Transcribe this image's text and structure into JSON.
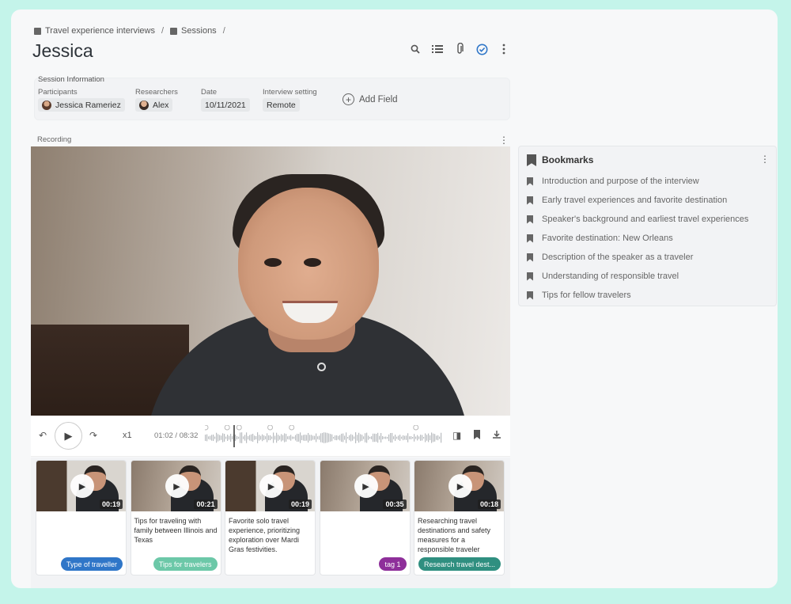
{
  "breadcrumb": {
    "project": "Travel experience interviews",
    "section": "Sessions",
    "sep": "/"
  },
  "page": {
    "title": "Jessica"
  },
  "toolbar": {
    "icons": [
      "search-icon",
      "list-icon",
      "paperclip-icon",
      "check-circle-icon",
      "more-vertical-icon"
    ]
  },
  "session": {
    "title": "Session Information",
    "participants_label": "Participants",
    "participant": "Jessica Rameriez",
    "researchers_label": "Researchers",
    "researcher": "Alex",
    "date_label": "Date",
    "date": "10/11/2021",
    "setting_label": "Interview setting",
    "setting": "Remote",
    "add_field": "Add Field"
  },
  "recording": {
    "label": "Recording",
    "speed": "x1",
    "time": "01:02 / 08:32",
    "progress": 0.12
  },
  "clips": [
    {
      "duration": "00:19",
      "text": "",
      "tag": "Type of traveller",
      "tag_color": "#2f76c8",
      "shelf": true
    },
    {
      "duration": "00:21",
      "text": "Tips for traveling with family between Illinois and Texas",
      "tag": "Tips for travelers",
      "tag_color": "#6cc8a8",
      "shelf": false
    },
    {
      "duration": "00:19",
      "text": "Favorite solo travel experience, prioritizing exploration over Mardi Gras festivities.",
      "tag": "",
      "tag_color": "",
      "shelf": true
    },
    {
      "duration": "00:35",
      "text": "",
      "tag": "tag 1",
      "tag_color": "#8e2f9a",
      "shelf": false
    },
    {
      "duration": "00:18",
      "text": "Researching travel destinations and safety measures for a responsible traveler",
      "tag": "Research travel dest...",
      "tag_color": "#2f8f80",
      "shelf": false
    }
  ],
  "bookmarks": {
    "title": "Bookmarks",
    "items": [
      "Introduction and purpose of the interview",
      "Early travel experiences and favorite destination",
      "Speaker's background and earliest travel experiences",
      "Favorite destination: New Orleans",
      "Description of the speaker as a traveler",
      "Understanding of responsible travel",
      "Tips for fellow travelers"
    ]
  },
  "colors": {
    "page_bg": "#c4f4ea",
    "accent_check": "#2f76c8"
  }
}
